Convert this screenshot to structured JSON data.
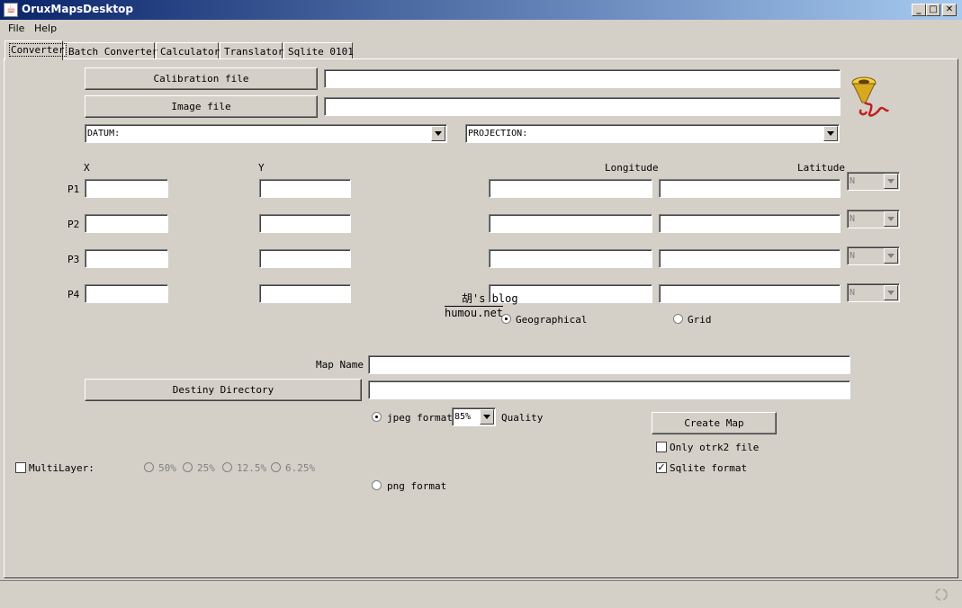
{
  "window": {
    "title": "OruxMapsDesktop",
    "min": "_",
    "max": "□",
    "close": "✕"
  },
  "menu": {
    "items": [
      "File",
      "Help"
    ]
  },
  "tabs": [
    "Converter",
    "Batch Converter",
    "Calculator",
    "Translator",
    "Sqlite 0101"
  ],
  "converter": {
    "calibration_button": "Calibration file",
    "calibration_value": "",
    "image_button": "Image file",
    "image_value": "",
    "datum_value": "DATUM:",
    "projection_value": "PROJECTION:",
    "col_x": "X",
    "col_y": "Y",
    "col_longitude": "Longitude",
    "col_latitude": "Latitude",
    "points": [
      {
        "label": "P1",
        "hemisphere": "N"
      },
      {
        "label": "P2",
        "hemisphere": "N"
      },
      {
        "label": "P3",
        "hemisphere": "N"
      },
      {
        "label": "P4",
        "hemisphere": "N"
      }
    ],
    "watermark_top": "胡's blog",
    "watermark_bottom": "humou.net",
    "coord_geographical": "Geographical",
    "coord_grid": "Grid",
    "map_name_label": "Map Name",
    "map_name_value": "",
    "destiny_button": "Destiny Directory",
    "destiny_value": "",
    "jpeg_label": "jpeg format",
    "quality_value": "85%",
    "quality_label": "Quality",
    "png_label": "png format",
    "create_button": "Create Map",
    "only_otrk2_label": "Only otrk2 file",
    "only_otrk2_checked": false,
    "sqlite_label": "Sqlite format",
    "sqlite_checked": true,
    "multilayer_label": "MultiLayer:",
    "multilayer_checked": false,
    "scales": [
      "50%",
      "25%",
      "12.5%",
      "6.25%"
    ]
  },
  "icons": {
    "app": "java-cup-icon",
    "logo": "oruxmaps-funnel-logo",
    "status": "busy-spinner-icon"
  },
  "colors": {
    "titlebar_start": "#0a246a",
    "titlebar_end": "#a6caf0",
    "background": "#d4d0c8",
    "logo_yellow": "#e8c020",
    "logo_red": "#c02020"
  }
}
